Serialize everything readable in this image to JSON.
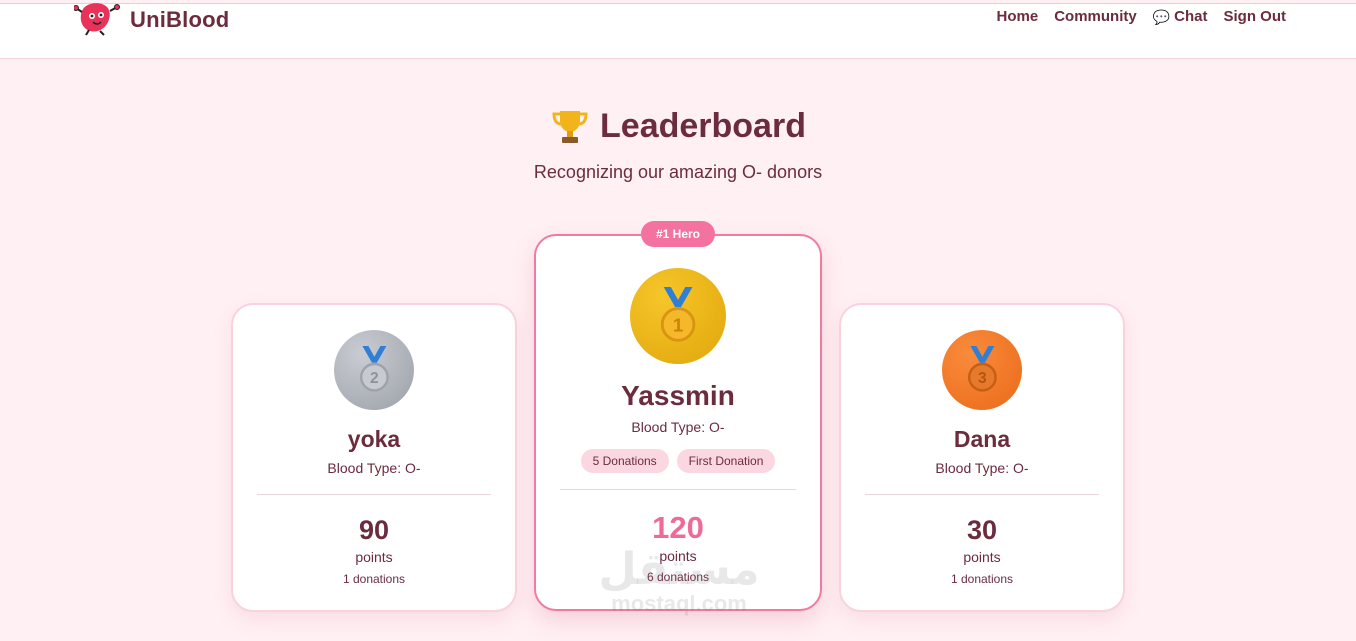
{
  "brand": {
    "name": "UniBlood",
    "logo_icon": "blood-drop-mascot-icon"
  },
  "nav": {
    "items": [
      {
        "label": "Home"
      },
      {
        "label": "Community"
      },
      {
        "label": "Chat",
        "icon": "speech-bubble-icon"
      },
      {
        "label": "Sign Out"
      }
    ]
  },
  "page": {
    "title": "Leaderboard",
    "title_icon": "trophy-icon",
    "subtitle": "Recognizing our amazing O- donors"
  },
  "leaders": {
    "first": {
      "badge": "#1 Hero",
      "medal": "gold-medal-icon",
      "name": "Yassmin",
      "blood_type": "Blood Type: O-",
      "tags": [
        "5 Donations",
        "First Donation"
      ],
      "points": "120",
      "points_label": "points",
      "donations": "6 donations"
    },
    "second": {
      "medal": "silver-medal-icon",
      "name": "yoka",
      "blood_type": "Blood Type: O-",
      "points": "90",
      "points_label": "points",
      "donations": "1 donations"
    },
    "third": {
      "medal": "bronze-medal-icon",
      "name": "Dana",
      "blood_type": "Blood Type: O-",
      "points": "30",
      "points_label": "points",
      "donations": "1 donations"
    }
  },
  "watermark": {
    "arabic": "مستقل",
    "latin": "mostaql.com"
  },
  "colors": {
    "accent": "#f472a0",
    "text": "#6b2c3e",
    "background": "#fff0f4",
    "gold": "#e8b20f",
    "silver": "#a7abb2",
    "bronze": "#f07a2a"
  }
}
